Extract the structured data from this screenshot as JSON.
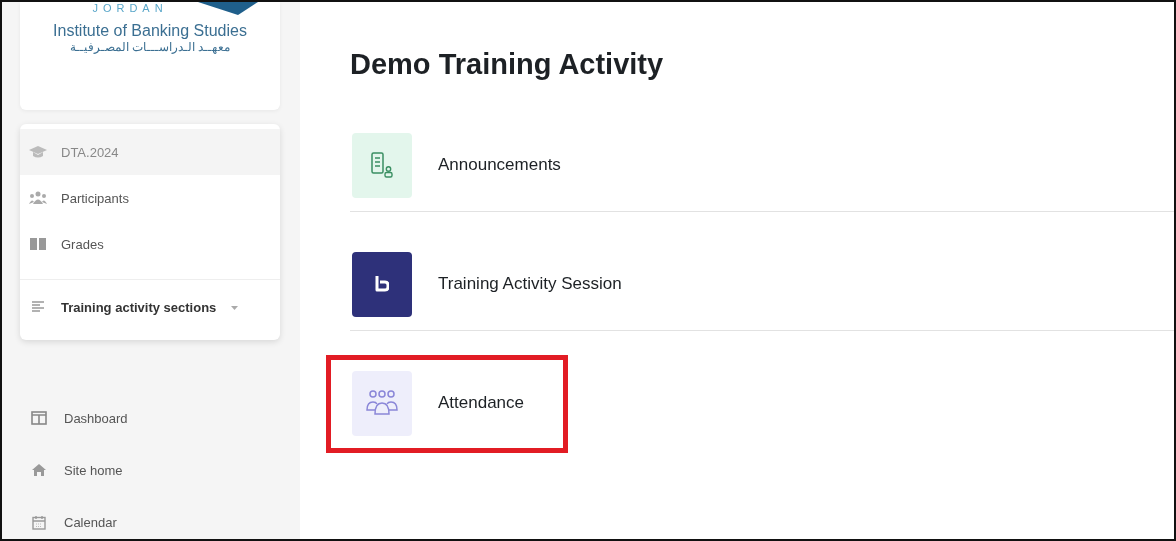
{
  "logo": {
    "country": "JORDAN",
    "name": "Institute of Banking Studies",
    "name_arabic": "معهــد الـدراســـات المصـرفيــة"
  },
  "course_menu": [
    {
      "label": "DTA.2024",
      "selected": true,
      "kind": "link"
    },
    {
      "label": "Participants",
      "selected": false,
      "kind": "link"
    },
    {
      "label": "Grades",
      "selected": false,
      "kind": "link"
    },
    {
      "label": "Training activity sections",
      "selected": false,
      "kind": "dropdown"
    }
  ],
  "nav": [
    {
      "label": "Dashboard"
    },
    {
      "label": "Site home"
    },
    {
      "label": "Calendar"
    }
  ],
  "page_title": "Demo Training Activity",
  "activities": [
    {
      "name": "Announcements",
      "kind": "forum",
      "highlighted": false
    },
    {
      "name": "Training Activity Session",
      "kind": "bigbluebutton",
      "highlighted": false
    },
    {
      "name": "Attendance",
      "kind": "attendance",
      "highlighted": true
    }
  ]
}
